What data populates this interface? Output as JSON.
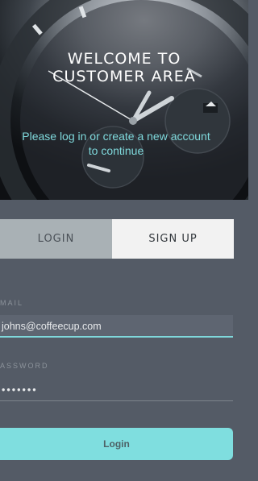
{
  "hero": {
    "title": "WELCOME TO\nCUSTOMER AREA",
    "subtitle": "Please log in or create a new account to continue"
  },
  "tabs": [
    {
      "label": "LOGIN",
      "active": false
    },
    {
      "label": "SIGN UP",
      "active": true
    }
  ],
  "form": {
    "email_label": "MAIL",
    "email_value": "johns@coffeecup.com",
    "password_label": "ASSWORD",
    "password_value": "•••••••",
    "login_button": "Login"
  },
  "colors": {
    "accent": "#7fdedf",
    "background": "#545b66",
    "tab_inactive": "#a9b1b5",
    "tab_active": "#f2f2f2"
  }
}
